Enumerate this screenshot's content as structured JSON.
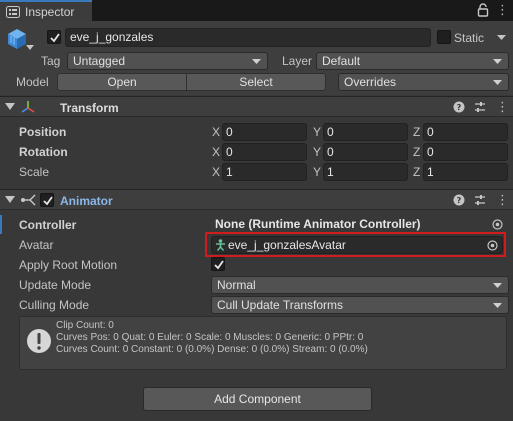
{
  "tab": {
    "title": "Inspector",
    "icon": "info-icon"
  },
  "header": {
    "object_name": "eve_j_gonzales",
    "active": true,
    "static_label": "Static",
    "tag_label": "Tag",
    "tag_value": "Untagged",
    "layer_label": "Layer",
    "layer_value": "Default",
    "model_label": "Model",
    "open_label": "Open",
    "select_label": "Select",
    "overrides_label": "Overrides"
  },
  "transform": {
    "title": "Transform",
    "rows": [
      {
        "label": "Position",
        "x": "0",
        "y": "0",
        "z": "0"
      },
      {
        "label": "Rotation",
        "x": "0",
        "y": "0",
        "z": "0"
      },
      {
        "label": "Scale",
        "x": "1",
        "y": "1",
        "z": "1"
      }
    ],
    "axes": {
      "x": "X",
      "y": "Y",
      "z": "Z"
    }
  },
  "animator": {
    "title": "Animator",
    "enabled": true,
    "controller_label": "Controller",
    "controller_value": "None (Runtime Animator Controller)",
    "avatar_label": "Avatar",
    "avatar_value": "eve_j_gonzalesAvatar",
    "apply_root_motion_label": "Apply Root Motion",
    "apply_root_motion": true,
    "update_mode_label": "Update Mode",
    "update_mode_value": "Normal",
    "culling_mode_label": "Culling Mode",
    "culling_mode_value": "Cull Update Transforms",
    "info_lines": [
      "Clip Count: 0",
      "Curves Pos: 0 Quat: 0 Euler: 0 Scale: 0 Muscles: 0 Generic: 0 PPtr: 0",
      "Curves Count: 0 Constant: 0 (0.0%) Dense: 0 (0.0%) Stream: 0 (0.0%)"
    ]
  },
  "add_component_label": "Add Component",
  "colors": {
    "accent": "#3a79bb",
    "highlight": "#d01c1c",
    "panel": "#383838"
  }
}
